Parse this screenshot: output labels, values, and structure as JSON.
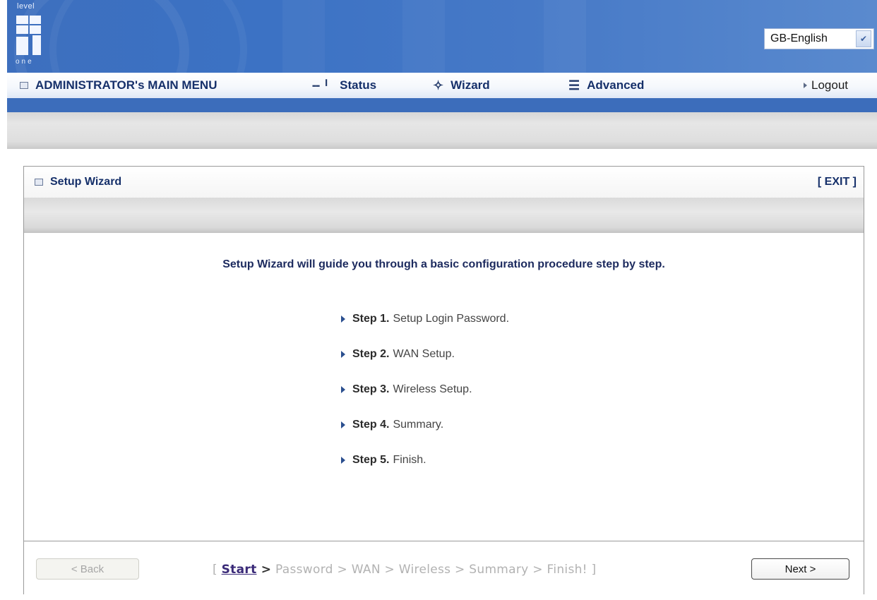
{
  "header": {
    "logo": {
      "top": "level",
      "bottom": "one"
    },
    "language": {
      "selected": "GB-English"
    }
  },
  "menu": {
    "main": "ADMINISTRATOR's MAIN MENU",
    "status": "Status",
    "wizard": "Wizard",
    "advanced": "Advanced",
    "logout": "Logout"
  },
  "panel": {
    "title": "Setup Wizard",
    "exit": "[ EXIT ]",
    "intro": "Setup Wizard will guide you through a basic configuration procedure step by step.",
    "steps": [
      {
        "num": "Step 1.",
        "text": "Setup Login Password."
      },
      {
        "num": "Step 2.",
        "text": "WAN Setup."
      },
      {
        "num": "Step 3.",
        "text": "Wireless Setup."
      },
      {
        "num": "Step 4.",
        "text": "Summary."
      },
      {
        "num": "Step 5.",
        "text": "Finish."
      }
    ]
  },
  "footer": {
    "back": "< Back",
    "next": "Next >",
    "trail": {
      "open": "[ ",
      "current": "Start",
      "first_sep": " >",
      "rest": " Password > WAN > Wireless > Summary > Finish! ]"
    }
  }
}
